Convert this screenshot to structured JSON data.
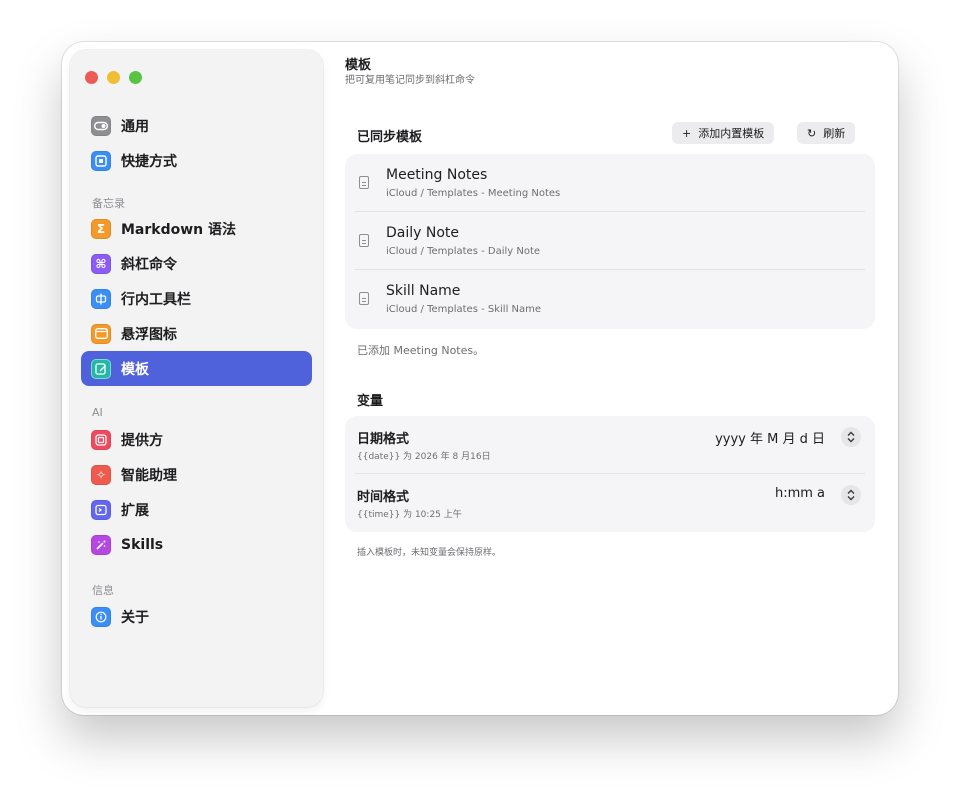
{
  "sidebar": {
    "sections": [
      {
        "label": "",
        "items": [
          {
            "label": "通用",
            "icon": "toggle-icon",
            "color": "#8e8e93"
          },
          {
            "label": "快捷方式",
            "icon": "keyboard-icon",
            "color": "#3a8ef5"
          }
        ]
      },
      {
        "label": "备忘录",
        "items": [
          {
            "label": "Markdown 语法",
            "icon": "sigma-icon",
            "color": "#f39a2b"
          },
          {
            "label": "斜杠命令",
            "icon": "command-icon",
            "color": "#8b5cf6"
          },
          {
            "label": "行内工具栏",
            "icon": "toolbar-icon",
            "color": "#3a8ef5"
          },
          {
            "label": "悬浮图标",
            "icon": "floating-window-icon",
            "color": "#f39a2b"
          },
          {
            "label": "模板",
            "icon": "template-edit-icon",
            "color": "#22b8a5",
            "active": true
          }
        ]
      },
      {
        "label": "AI",
        "items": [
          {
            "label": "提供方",
            "icon": "provider-icon",
            "color": "#ef4a5f"
          },
          {
            "label": "智能助理",
            "icon": "sparkle-assistant-icon",
            "color": "#ef5a4f"
          },
          {
            "label": "扩展",
            "icon": "extension-icon",
            "color": "#6366f1"
          },
          {
            "label": "Skills",
            "icon": "magic-wand-icon",
            "color": "#b548e0"
          }
        ]
      },
      {
        "label": "信息",
        "items": [
          {
            "label": "关于",
            "icon": "info-icon",
            "color": "#3a8ef5"
          }
        ]
      }
    ]
  },
  "header": {
    "title": "模板",
    "subtitle": "把可复用笔记同步到斜杠命令"
  },
  "synced": {
    "title": "已同步模板",
    "add_button": {
      "icon": "+",
      "label": "添加内置模板"
    },
    "refresh_button": {
      "icon": "↻",
      "label": "刷新"
    },
    "templates": [
      {
        "name": "Meeting Notes",
        "path": "iCloud / Templates - Meeting Notes"
      },
      {
        "name": "Daily Note",
        "path": "iCloud / Templates - Daily Note"
      },
      {
        "name": "Skill Name",
        "path": "iCloud / Templates - Skill Name"
      }
    ],
    "status": "已添加 Meeting Notes。"
  },
  "variables": {
    "title": "变量",
    "items": [
      {
        "name": "日期格式",
        "desc": "{{date}} 为 2026 年 8 月16日",
        "value": "yyyy 年 M 月 d 日"
      },
      {
        "name": "时间格式",
        "desc": "{{time}} 为 10:25 上午",
        "value": "h:mm a"
      }
    ],
    "footnote": "插入模板时，未知变量会保持原样。"
  }
}
